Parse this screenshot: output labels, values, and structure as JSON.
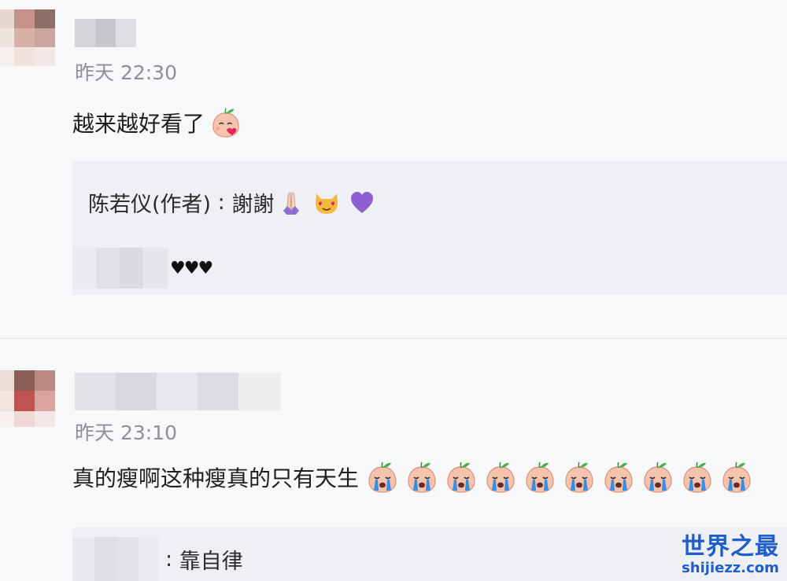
{
  "comments": [
    {
      "timestamp": "昨天 22:30",
      "text": "越来越好看了",
      "text_emoji": "peach-kiss",
      "replies": [
        {
          "author": "陈若仪(作者)",
          "separator": " : ",
          "text": "謝謝",
          "emojis": [
            "praying-hands",
            "heart-eyes-cat",
            "purple-heart"
          ]
        },
        {
          "text": "♥♥♥"
        }
      ]
    },
    {
      "timestamp": "昨天 23:10",
      "text": "真的瘦啊这种瘦真的只有天生",
      "text_emoji": "peach-crying",
      "text_emoji_count": 10,
      "replies": [
        {
          "separator": ": ",
          "text": "靠自律"
        }
      ]
    }
  ],
  "watermark": {
    "title": "世界之最",
    "url": "shijiezz.com"
  },
  "colors": {
    "background": "#f7f8fa",
    "reply_background": "#eef0f5",
    "timestamp": "#8e9096",
    "watermark": "#1e5ec8"
  }
}
